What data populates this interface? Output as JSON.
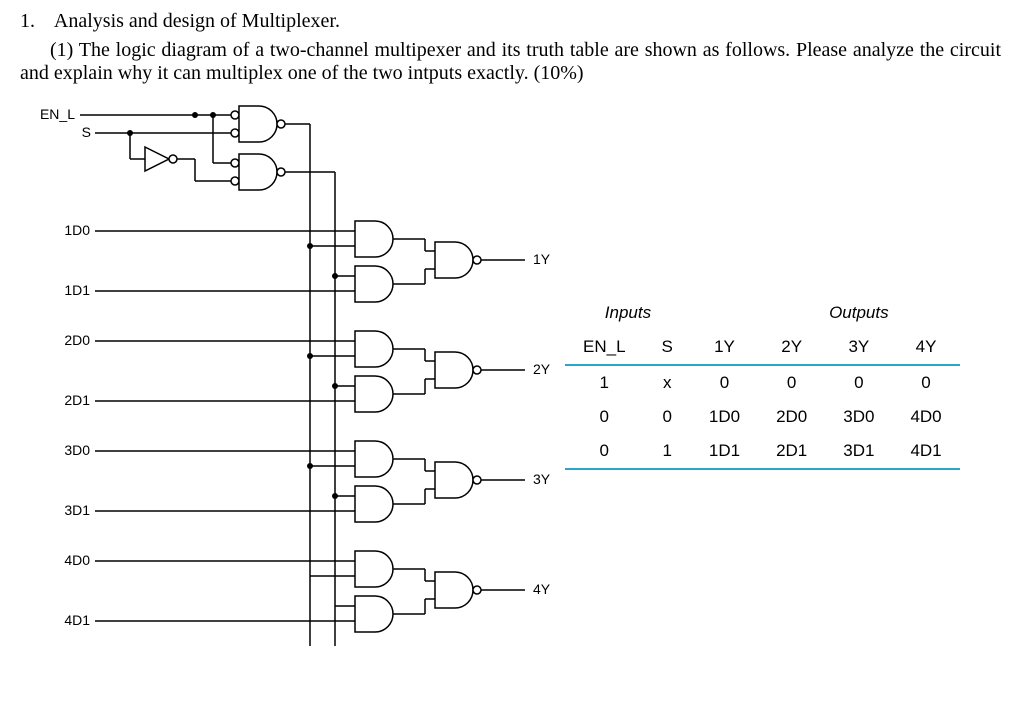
{
  "question": {
    "number": "1.",
    "title": "Analysis and design of Multiplexer.",
    "part_label": "(1)",
    "body": "The logic diagram of a two-channel multipexer and its truth table are shown as follows. Please analyze the circuit and explain why it can multiplex one of the two intputs exactly.  (10%)"
  },
  "signals": {
    "enable": "EN_L",
    "select": "S",
    "inputs": [
      "1D0",
      "1D1",
      "2D0",
      "2D1",
      "3D0",
      "3D1",
      "4D0",
      "4D1"
    ],
    "outputs": [
      "1Y",
      "2Y",
      "3Y",
      "4Y"
    ]
  },
  "truth_table": {
    "group_headers": {
      "inputs": "Inputs",
      "outputs": "Outputs"
    },
    "columns": [
      "EN_L",
      "S",
      "1Y",
      "2Y",
      "3Y",
      "4Y"
    ],
    "rows": [
      {
        "EN_L": "1",
        "S": "x",
        "1Y": "0",
        "2Y": "0",
        "3Y": "0",
        "4Y": "0"
      },
      {
        "EN_L": "0",
        "S": "0",
        "1Y": "1D0",
        "2Y": "2D0",
        "3Y": "3D0",
        "4Y": "4D0"
      },
      {
        "EN_L": "0",
        "S": "1",
        "1Y": "1D1",
        "2Y": "2D1",
        "3Y": "3D1",
        "4Y": "4D1"
      }
    ]
  }
}
